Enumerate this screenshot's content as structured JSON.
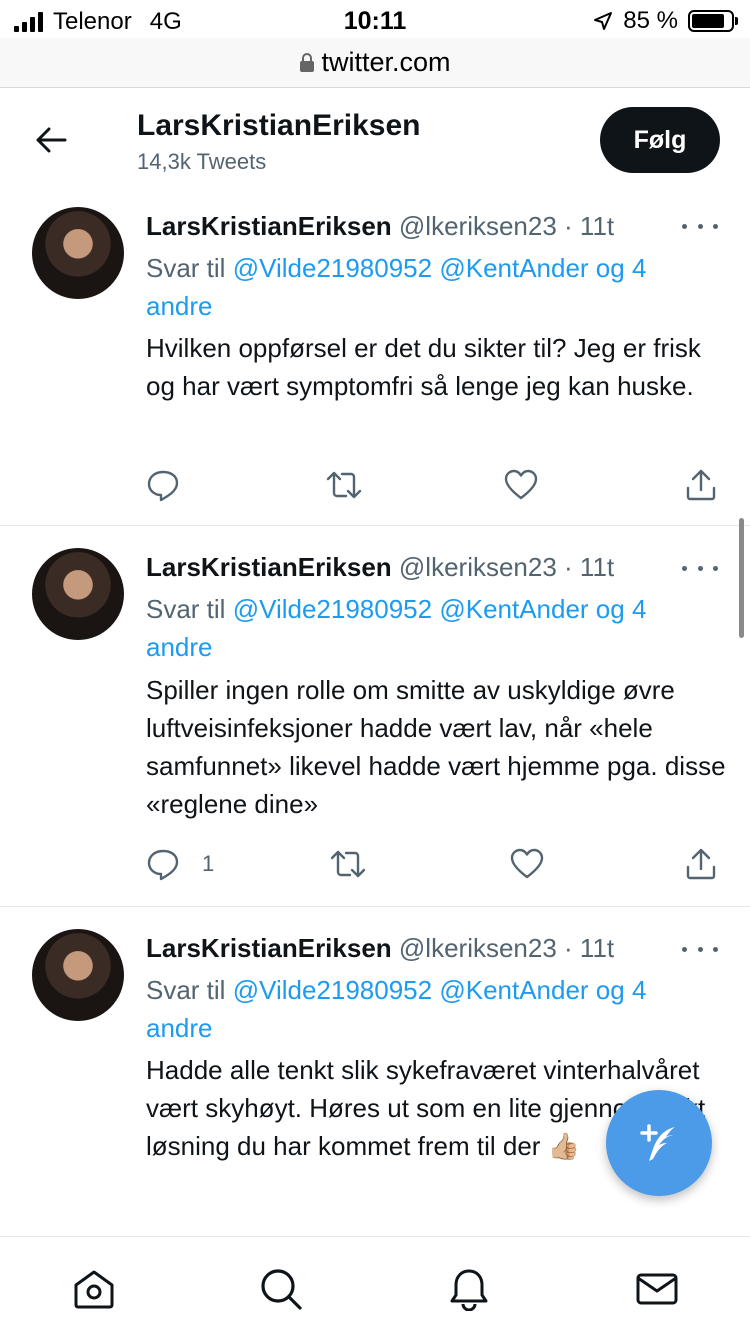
{
  "status_bar": {
    "carrier": "Telenor",
    "network": "4G",
    "time": "10:11",
    "battery": "85 %",
    "battery_level": 0.85
  },
  "browser": {
    "url": "twitter.com"
  },
  "profile_header": {
    "name": "LarsKristianEriksen",
    "tweet_count": "14,3k Tweets",
    "follow_label": "Følg"
  },
  "tweets": [
    {
      "name": "LarsKristianEriksen",
      "handle": "@lkeriksen23 · 11t",
      "reply_prefix": "Svar til ",
      "reply_mentions": "@Vilde21980952 @KentAnder og 4 andre",
      "text": "Hvilken oppførsel er det du sikter til? Jeg er frisk og har vært symptomfri så lenge jeg kan huske.",
      "reply_count": ""
    },
    {
      "name": "LarsKristianEriksen",
      "handle": "@lkeriksen23 · 11t",
      "reply_prefix": "Svar til ",
      "reply_mentions": "@Vilde21980952 @KentAnder og 4 andre",
      "text": "Spiller ingen rolle om smitte av uskyldige øvre luftveisinfeksjoner hadde vært lav, når «hele samfunnet» likevel hadde vært hjemme pga. disse «reglene dine»",
      "reply_count": "1"
    },
    {
      "name": "LarsKristianEriksen",
      "handle": "@lkeriksen23 · 11t",
      "reply_prefix": "Svar til ",
      "reply_mentions": "@Vilde21980952 @KentAnder og 4 andre",
      "text": "Hadde alle tenkt slik sykefraværet vinterhalvåret vært skyhøyt. Høres ut som en lite gjennomtenkt løsning du har kommet frem til der 👍🏼",
      "reply_count": ""
    }
  ],
  "icons": {
    "back": "arrow-left-icon",
    "reply": "chat-bubble-icon",
    "retweet": "retweet-icon",
    "like": "heart-icon",
    "share": "share-icon",
    "more": "more-icon",
    "compose": "compose-icon",
    "home": "home-icon",
    "search": "search-icon",
    "notifications": "bell-icon",
    "messages": "mail-icon"
  },
  "colors": {
    "link": "#1d9bf0",
    "fab": "#4c9be8",
    "follow_bg": "#0f1419"
  }
}
